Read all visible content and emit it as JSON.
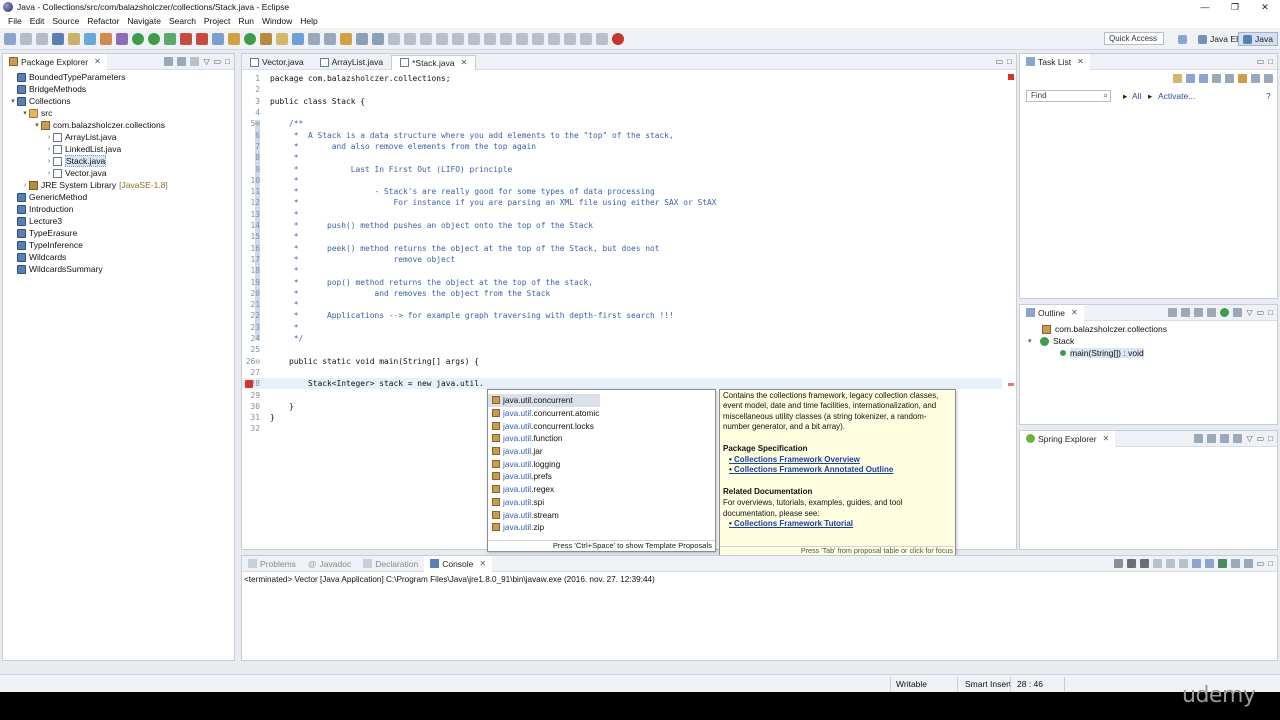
{
  "window": {
    "title": "Java - Collections/src/com/balazsholczer/collections/Stack.java - Eclipse",
    "controls": [
      "—",
      "❐",
      "✕"
    ]
  },
  "menu": [
    "File",
    "Edit",
    "Source",
    "Refactor",
    "Navigate",
    "Search",
    "Project",
    "Run",
    "Window",
    "Help"
  ],
  "toolbar": {
    "quick_access": "Quick Access",
    "perspectives": [
      "Java EE",
      "Java"
    ]
  },
  "package_explorer": {
    "title": "Package Explorer",
    "items": [
      {
        "label": "BoundedTypeParameters",
        "type": "project",
        "depth": 0,
        "arrow": ""
      },
      {
        "label": "BridgeMethods",
        "type": "project",
        "depth": 0,
        "arrow": ""
      },
      {
        "label": "Collections",
        "type": "project",
        "depth": 0,
        "arrow": "▾"
      },
      {
        "label": "src",
        "type": "src",
        "depth": 1,
        "arrow": "▾"
      },
      {
        "label": "com.balazsholczer.collections",
        "type": "pkg",
        "depth": 2,
        "arrow": "▾"
      },
      {
        "label": "ArrayList.java",
        "type": "java",
        "depth": 3,
        "arrow": "›"
      },
      {
        "label": "LinkedList.java",
        "type": "java",
        "depth": 3,
        "arrow": "›"
      },
      {
        "label": "Stack.java",
        "type": "java",
        "depth": 3,
        "arrow": "›",
        "selected": true
      },
      {
        "label": "Vector.java",
        "type": "java",
        "depth": 3,
        "arrow": "›"
      },
      {
        "label": "JRE System Library",
        "suffix": "[JavaSE-1.8]",
        "type": "lib",
        "depth": 1,
        "arrow": "›"
      },
      {
        "label": "GenericMethod",
        "type": "project",
        "depth": 0,
        "arrow": ""
      },
      {
        "label": "Introduction",
        "type": "project",
        "depth": 0,
        "arrow": ""
      },
      {
        "label": "Lecture3",
        "type": "project",
        "depth": 0,
        "arrow": ""
      },
      {
        "label": "TypeErasure",
        "type": "project",
        "depth": 0,
        "arrow": ""
      },
      {
        "label": "TypeInference",
        "type": "project",
        "depth": 0,
        "arrow": ""
      },
      {
        "label": "Wildcards",
        "type": "project",
        "depth": 0,
        "arrow": ""
      },
      {
        "label": "WildcardsSummary",
        "type": "project",
        "depth": 0,
        "arrow": ""
      }
    ]
  },
  "editor": {
    "tabs": [
      {
        "label": "Vector.java",
        "active": false
      },
      {
        "label": "ArrayList.java",
        "active": false
      },
      {
        "label": "*Stack.java",
        "active": true
      }
    ],
    "lines": [
      {
        "n": "1",
        "text": "package com.balazsholczer.collections;",
        "cls": "kw"
      },
      {
        "n": "2",
        "text": "",
        "cls": ""
      },
      {
        "n": "3",
        "text": "public class Stack {",
        "cls": "kw"
      },
      {
        "n": "4",
        "text": "",
        "cls": ""
      },
      {
        "n": "5⊖",
        "text": "    /**",
        "cls": "comment"
      },
      {
        "n": "6",
        "text": "     *  A Stack is a data structure where you add elements to the \"top\" of the stack,",
        "cls": "comment"
      },
      {
        "n": "7",
        "text": "     *       and also remove elements from the top again",
        "cls": "comment"
      },
      {
        "n": "8",
        "text": "     *",
        "cls": "comment"
      },
      {
        "n": "9",
        "text": "     *           Last In First Out (LIFO) principle",
        "cls": "comment"
      },
      {
        "n": "10",
        "text": "     *",
        "cls": "comment"
      },
      {
        "n": "11",
        "text": "     *                - Stack's are really good for some types of data processing",
        "cls": "comment"
      },
      {
        "n": "12",
        "text": "     *                    For instance if you are parsing an XML file using either SAX or StAX",
        "cls": "comment"
      },
      {
        "n": "13",
        "text": "     *",
        "cls": "comment"
      },
      {
        "n": "14",
        "text": "     *      push() method pushes an object onto the top of the Stack",
        "cls": "comment"
      },
      {
        "n": "15",
        "text": "     *",
        "cls": "comment"
      },
      {
        "n": "16",
        "text": "     *      peek() method returns the object at the top of the Stack, but does not",
        "cls": "comment"
      },
      {
        "n": "17",
        "text": "     *                    remove object",
        "cls": "comment"
      },
      {
        "n": "18",
        "text": "     *",
        "cls": "comment"
      },
      {
        "n": "19",
        "text": "     *      pop() method returns the object at the top of the stack,",
        "cls": "comment"
      },
      {
        "n": "20",
        "text": "     *                and removes the object from the Stack",
        "cls": "comment"
      },
      {
        "n": "21",
        "text": "     *",
        "cls": "comment"
      },
      {
        "n": "22",
        "text": "     *      Applications --> for example graph traversing with depth-first search !!!",
        "cls": "comment"
      },
      {
        "n": "23",
        "text": "     *",
        "cls": "comment"
      },
      {
        "n": "24",
        "text": "     */",
        "cls": "comment"
      },
      {
        "n": "25",
        "text": "",
        "cls": ""
      },
      {
        "n": "26⊖",
        "text": "    public static void main(String[] args) {",
        "cls": "kw"
      },
      {
        "n": "27",
        "text": "",
        "cls": ""
      },
      {
        "n": "28",
        "text": "        Stack<Integer> stack = new java.util.",
        "cls": "kw",
        "current": true,
        "error": true
      },
      {
        "n": "29",
        "text": "",
        "cls": ""
      },
      {
        "n": "30",
        "text": "    }",
        "cls": "kw"
      },
      {
        "n": "31",
        "text": "}",
        "cls": "kw"
      },
      {
        "n": "32",
        "text": "",
        "cls": ""
      }
    ]
  },
  "content_assist": {
    "prefix": "java.util",
    "proposals": [
      {
        "rest": ".concurrent",
        "selected": true
      },
      {
        "rest": ".concurrent.atomic"
      },
      {
        "rest": ".concurrent.locks"
      },
      {
        "rest": ".function"
      },
      {
        "rest": ".jar"
      },
      {
        "rest": ".logging"
      },
      {
        "rest": ".prefs"
      },
      {
        "rest": ".regex"
      },
      {
        "rest": ".spi"
      },
      {
        "rest": ".stream"
      },
      {
        "rest": ".zip"
      }
    ],
    "status": "Press 'Ctrl+Space' to show Template Proposals"
  },
  "doc_popup": {
    "intro": "Contains the collections framework, legacy collection classes, event model, date and time facilities, internationalization, and miscellaneous utility classes (a string tokenizer, a random-number generator, and a bit array).",
    "spec_heading": "Package Specification",
    "spec_links": [
      "Collections Framework Overview",
      "Collections Framework Annotated Outline"
    ],
    "related_heading": "Related Documentation",
    "related_text": "For overviews, tutorials, examples, guides, and tool documentation, please see:",
    "related_links": [
      "Collections Framework Tutorial"
    ],
    "status": "Press 'Tab' from proposal table or click for focus"
  },
  "task_list": {
    "title": "Task List",
    "find_placeholder": "Find",
    "all_label": "All",
    "activate_label": "Activate..."
  },
  "outline": {
    "title": "Outline",
    "items": [
      {
        "label": "com.balazsholczer.collections",
        "type": "pkg"
      },
      {
        "label": "Stack",
        "type": "class"
      },
      {
        "label": "main(String[]) : void",
        "type": "method",
        "selected": true
      }
    ]
  },
  "spring_explorer": {
    "title": "Spring Explorer"
  },
  "console": {
    "tabs": [
      {
        "label": "Problems",
        "active": false
      },
      {
        "label": "Javadoc",
        "active": false
      },
      {
        "label": "Declaration",
        "active": false
      },
      {
        "label": "Console",
        "active": true
      }
    ],
    "text": "<terminated> Vector [Java Application] C:\\Program Files\\Java\\jre1.8.0_91\\bin\\javaw.exe (2016. nov. 27. 12:39:44)"
  },
  "statusbar": {
    "writable": "Writable",
    "insert_mode": "Smart Insert",
    "position": "28 : 46"
  },
  "watermark": "udemy",
  "colors": {
    "comment": "#3a63a8",
    "error": "#d9312c",
    "link": "#1a3ea8",
    "doc_bg": "#fffee1"
  }
}
